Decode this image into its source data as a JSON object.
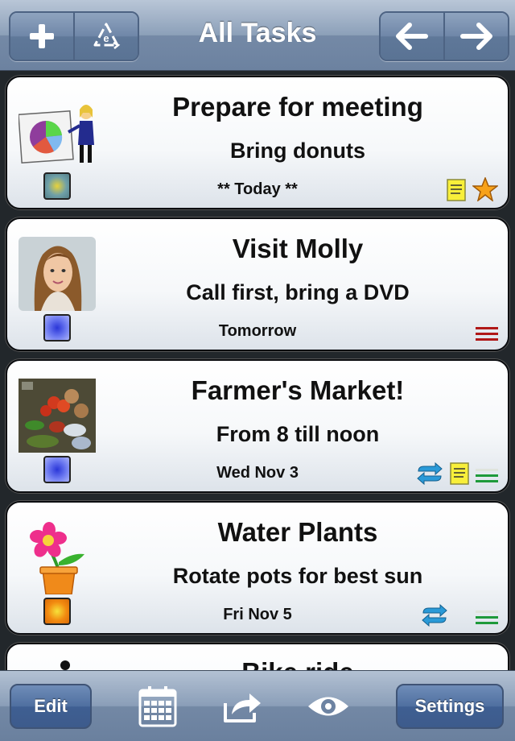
{
  "nav": {
    "title": "All Tasks",
    "add_icon": "plus-icon",
    "recycle_icon": "recycle-e-icon",
    "back_icon": "arrow-left-icon",
    "forward_icon": "arrow-right-icon"
  },
  "tasks": [
    {
      "title": "Prepare for meeting",
      "note": "Bring donuts",
      "date": "** Today **",
      "thumbnail": "presentation-pie-chart-icon",
      "priority_color": "#6fa0a8",
      "indicators": [
        "note-icon",
        "star-icon"
      ]
    },
    {
      "title": "Visit Molly",
      "note": "Call first, bring a DVD",
      "date": "Tomorrow",
      "thumbnail": "contact-photo",
      "priority_color": "#4b58e8",
      "indicators": [
        "red-bars-icon"
      ]
    },
    {
      "title": "Farmer's Market!",
      "note": "From 8 till noon",
      "date": "Wed Nov 3",
      "thumbnail": "vegetables-photo",
      "priority_color": "#4b58e8",
      "indicators": [
        "repeat-icon",
        "note-icon",
        "green-bars-icon"
      ]
    },
    {
      "title": "Water Plants",
      "note": "Rotate pots for best sun",
      "date": "Fri Nov 5",
      "thumbnail": "flower-pot-icon",
      "priority_color": "#f28a10",
      "indicators": [
        "repeat-icon",
        "green-bars-icon"
      ]
    },
    {
      "title": "Bike ride",
      "thumbnail": "cyclist-icon"
    }
  ],
  "toolbar": {
    "edit_label": "Edit",
    "settings_label": "Settings",
    "calendar_icon": "calendar-icon",
    "share_icon": "share-arrow-icon",
    "eye_icon": "eye-icon"
  }
}
